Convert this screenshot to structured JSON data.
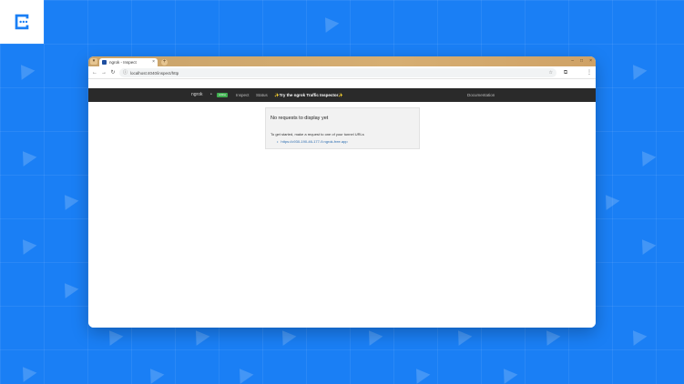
{
  "browser": {
    "tab_title": "ngrok - Inspect",
    "tab_close": "×",
    "tab_menu": "▾",
    "new_tab": "+",
    "window_controls": {
      "minimize": "–",
      "maximize": "□",
      "close": "×"
    },
    "nav": {
      "back": "←",
      "forward": "→",
      "reload": "↻"
    },
    "url": "localhost:4040/inspect/http",
    "star": "☆",
    "extensions": "⧉",
    "menu": "⋮"
  },
  "app_nav": {
    "brand": "ngrok",
    "separator": "•",
    "status_badge": "online",
    "inspect": "Inspect",
    "status": "Status",
    "promo": "✨Try the ngrok Traffic Inspector✨",
    "documentation": "Documentation"
  },
  "empty_state": {
    "title": "No requests to display yet",
    "hint": "To get started, make a request to one of your tunnel URLs",
    "bullet": "•",
    "tunnel_url": "https://c930-190-46-177-9.ngrok-free.app"
  },
  "colors": {
    "background": "#1a7ff5",
    "tabstrip": "#d6ae72",
    "appnav": "#2a2a2a",
    "badge": "#3fae4f",
    "link": "#2b6cb0"
  },
  "icons": {
    "logo": "chat-bubble-icon",
    "background_pattern": "paper-plane-icon"
  }
}
